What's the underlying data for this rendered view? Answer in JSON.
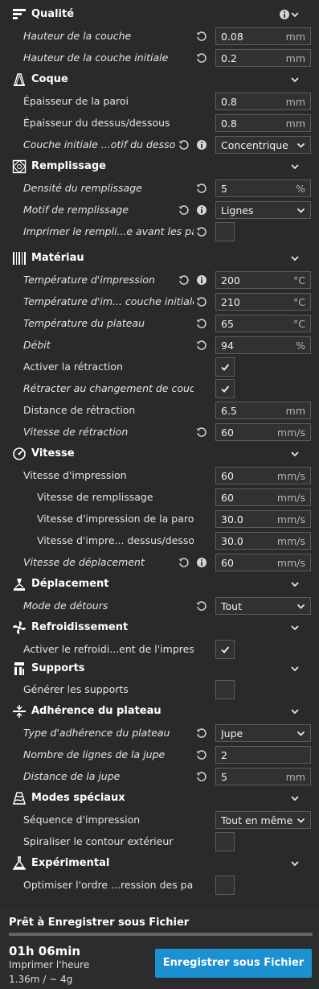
{
  "colors": {
    "background": "#282a2c",
    "accent_button": "#1c91d1",
    "text": "#e6e6e6",
    "field_border": "#5a5c5f"
  },
  "categories": {
    "quality": {
      "title": "Qualité",
      "icon": "quality-icon"
    },
    "shell": {
      "title": "Coque",
      "icon": "shell-icon"
    },
    "infill": {
      "title": "Remplissage",
      "icon": "infill-icon"
    },
    "material": {
      "title": "Matériau",
      "icon": "material-icon"
    },
    "speed": {
      "title": "Vitesse",
      "icon": "speed-icon"
    },
    "travel": {
      "title": "Déplacement",
      "icon": "travel-icon"
    },
    "cooling": {
      "title": "Refroidissement",
      "icon": "cooling-icon"
    },
    "support": {
      "title": "Supports",
      "icon": "support-icon"
    },
    "adhesion": {
      "title": "Adhérence du plateau",
      "icon": "adhesion-icon"
    },
    "special": {
      "title": "Modes spéciaux",
      "icon": "special-modes-icon"
    },
    "experimental": {
      "title": "Expérimental",
      "icon": "experimental-icon"
    }
  },
  "settings": {
    "layer_height": {
      "label": "Hauteur de la couche",
      "value": "0.08",
      "unit": "mm"
    },
    "initial_layer_height": {
      "label": "Hauteur de la couche initiale",
      "value": "0.2",
      "unit": "mm"
    },
    "wall_thickness": {
      "label": "Épaisseur de la paroi",
      "value": "0.8",
      "unit": "mm"
    },
    "top_bottom_thickness": {
      "label": "Épaisseur du dessus/dessous",
      "value": "0.8",
      "unit": "mm"
    },
    "initial_layer_pattern": {
      "label": "Couche initiale ...otif du dessous.",
      "value": "Concentrique"
    },
    "infill_density": {
      "label": "Densité du remplissage",
      "value": "5",
      "unit": "%"
    },
    "infill_pattern": {
      "label": "Motif de remplissage",
      "value": "Lignes"
    },
    "infill_before_walls": {
      "label": "Imprimer le rempli...e avant les parois",
      "checked": false
    },
    "print_temp": {
      "label": "Température d'impression",
      "value": "200",
      "unit": "°C"
    },
    "print_temp_initial": {
      "label": "Température d'im... couche initiale",
      "value": "210",
      "unit": "°C"
    },
    "bed_temp": {
      "label": "Température du plateau",
      "value": "65",
      "unit": "°C"
    },
    "flow": {
      "label": "Débit",
      "value": "94",
      "unit": "%"
    },
    "retraction_enable": {
      "label": "Activer la rétraction",
      "checked": true
    },
    "retract_layer_change": {
      "label": "Rétracter au changement de couche",
      "checked": true
    },
    "retraction_distance": {
      "label": "Distance de rétraction",
      "value": "6.5",
      "unit": "mm"
    },
    "retraction_speed": {
      "label": "Vitesse de rétraction",
      "value": "60",
      "unit": "mm/s"
    },
    "print_speed": {
      "label": "Vitesse d'impression",
      "value": "60",
      "unit": "mm/s"
    },
    "infill_speed": {
      "label": "Vitesse de remplissage",
      "value": "60",
      "unit": "mm/s"
    },
    "wall_speed": {
      "label": "Vitesse d'impression de la paroi",
      "value": "30.0",
      "unit": "mm/s"
    },
    "topbottom_speed": {
      "label": "Vitesse d'impre... dessus/dessous",
      "value": "30.0",
      "unit": "mm/s"
    },
    "travel_speed": {
      "label": "Vitesse de déplacement",
      "value": "60",
      "unit": "mm/s"
    },
    "combing_mode": {
      "label": "Mode de détours",
      "value": "Tout"
    },
    "cooling_enable": {
      "label": "Activer le refroidi...ent de l'impression",
      "checked": true
    },
    "support_enable": {
      "label": "Générer les supports",
      "checked": false
    },
    "adhesion_type": {
      "label": "Type d'adhérence du plateau",
      "value": "Jupe"
    },
    "skirt_lines": {
      "label": "Nombre de lignes de la jupe",
      "value": "2",
      "unit": ""
    },
    "skirt_distance": {
      "label": "Distance de la jupe",
      "value": "5",
      "unit": "mm"
    },
    "print_sequence": {
      "label": "Séquence d'impression",
      "value": "Tout en même temps"
    },
    "spiralize": {
      "label": "Spiraliser le contour extérieur",
      "checked": false
    },
    "optimize_wall_order": {
      "label": "Optimiser l'ordre ...ression des parois",
      "checked": false
    }
  },
  "footer": {
    "title": "Prêt à Enregistrer sous Fichier",
    "progress": 1.0,
    "time": "01h 06min",
    "time_label": "Imprimer l'heure",
    "material": "1.36m / ~ 4g",
    "save_button": "Enregistrer sous Fichier"
  }
}
